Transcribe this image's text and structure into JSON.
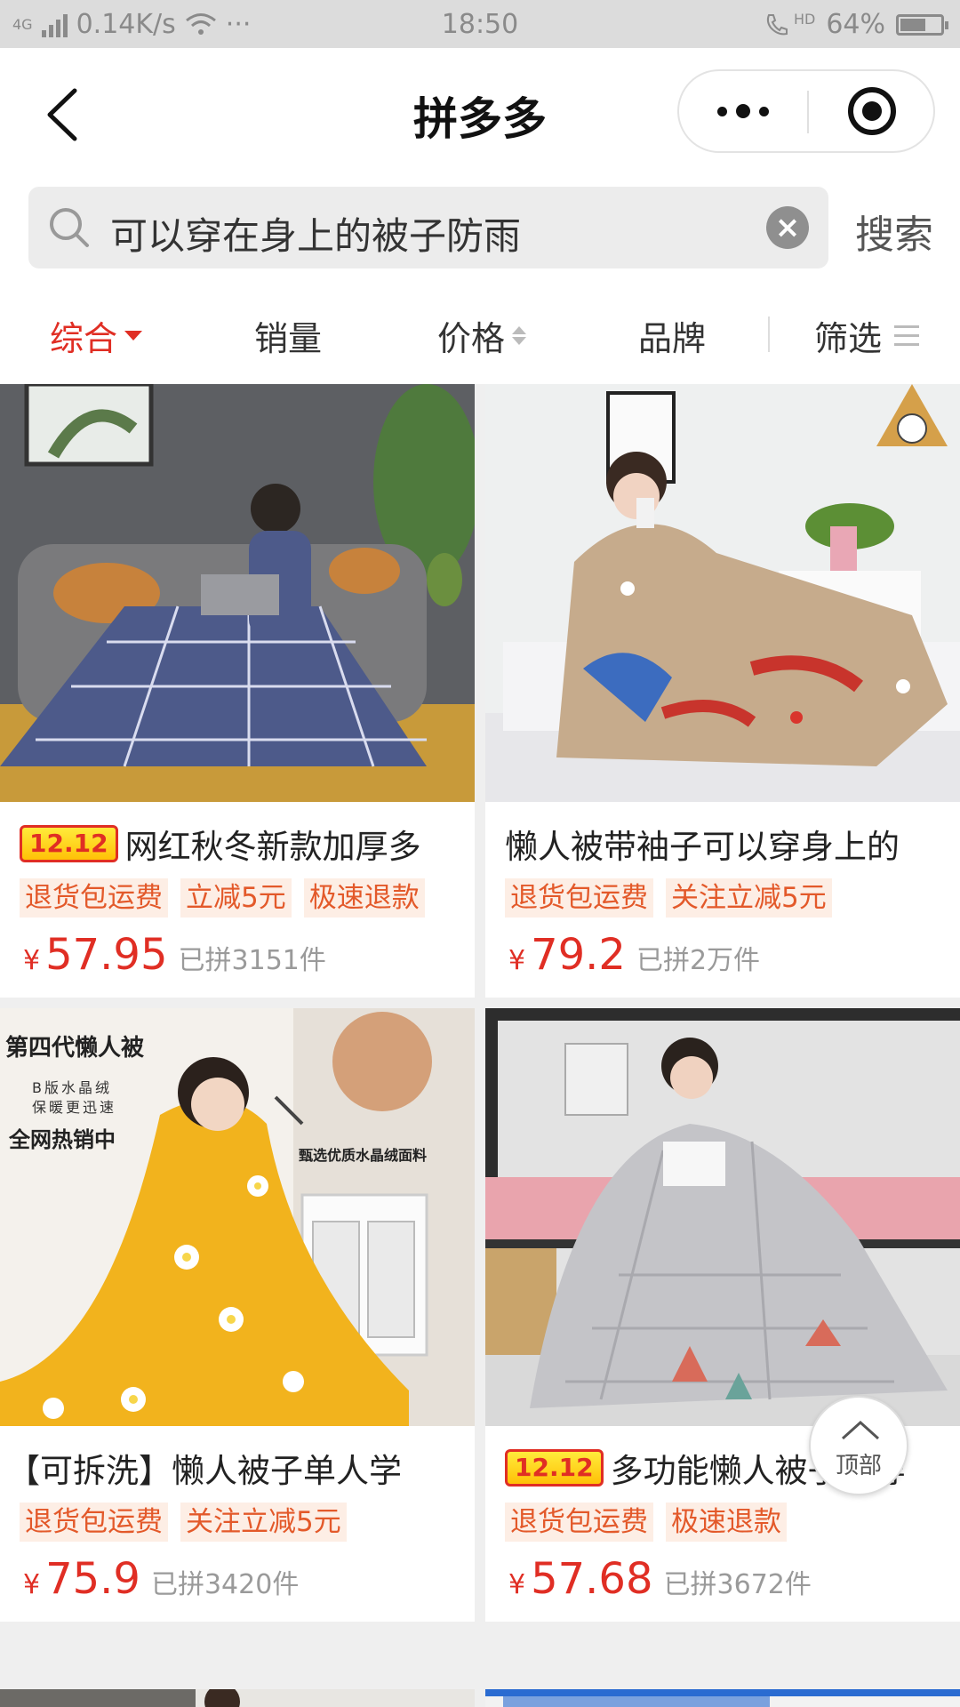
{
  "status_bar": {
    "network": "4G",
    "speed": "0.14K/s",
    "dots": "···",
    "time": "18:50",
    "hd": "HD",
    "battery_text": "64%",
    "battery_level": 0.64
  },
  "navbar": {
    "title": "拼多多"
  },
  "search": {
    "query": "可以穿在身上的被子防雨",
    "clear_glyph": "×",
    "button_label": "搜索"
  },
  "sort": {
    "comprehensive": "综合",
    "sales": "销量",
    "price": "价格",
    "brand": "品牌",
    "filter": "筛选"
  },
  "products": [
    {
      "badge": "12.12",
      "title": "网红秋冬新款加厚多",
      "tags": [
        "退货包运费",
        "立减5元",
        "极速退款"
      ],
      "currency": "¥",
      "price": "57.95",
      "sold": "已拼3151件"
    },
    {
      "badge": "",
      "title": "懒人被带袖子可以穿身上的",
      "tags": [
        "退货包运费",
        "关注立减5元"
      ],
      "currency": "¥",
      "price": "79.2",
      "sold": "已拼2万件"
    },
    {
      "badge": "",
      "title": "【可拆洗】懒人被子单人学",
      "tags": [
        "退货包运费",
        "关注立减5元"
      ],
      "currency": "¥",
      "price": "75.9",
      "sold": "已拼3420件",
      "image_text": {
        "line1": "第四代懒人被",
        "line2": "B版水晶绒",
        "line3": "保暖更迅速",
        "line4": "全网热销中",
        "line5": "甄选优质水晶绒面料"
      }
    },
    {
      "badge": "12.12",
      "title": "多功能懒人被子可穿",
      "tags": [
        "退货包运费",
        "极速退款"
      ],
      "currency": "¥",
      "price": "57.68",
      "sold": "已拼3672件"
    }
  ],
  "back_to_top": {
    "label": "顶部"
  },
  "colors": {
    "accent_red": "#e02e24",
    "tag_bg": "#fdeee5",
    "tag_text": "#e3592a"
  }
}
